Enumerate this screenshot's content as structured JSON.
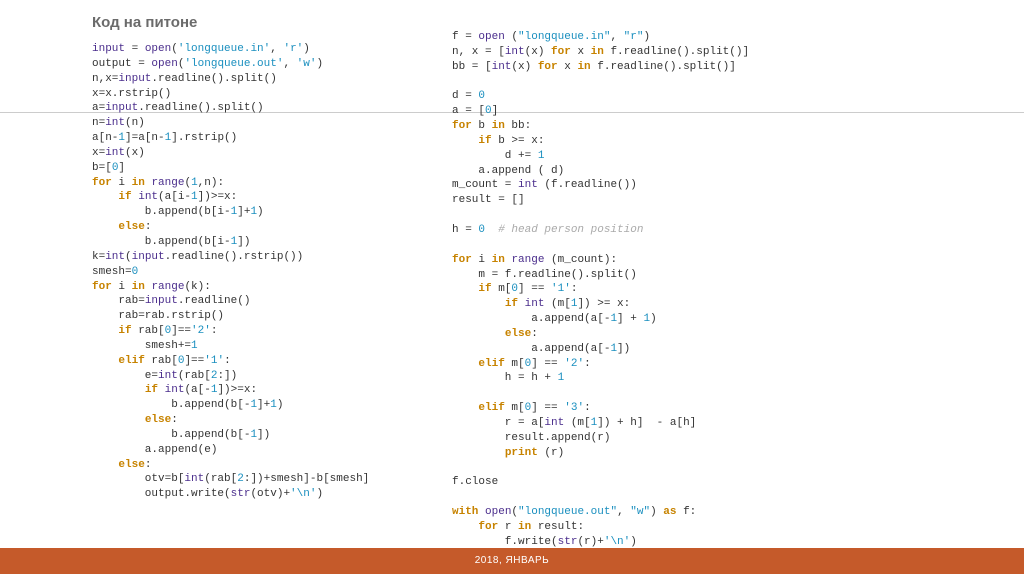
{
  "title": "Код на питоне",
  "footer": "2018, ЯНВАРЬ",
  "code1": {
    "l1": {
      "a": "input",
      "b": " = ",
      "c": "open",
      "d": "(",
      "e": "'longqueue.in'",
      "f": ", ",
      "g": "'r'",
      "h": ")"
    },
    "l2": {
      "a": "output = ",
      "b": "open",
      "c": "(",
      "d": "'longqueue.out'",
      "e": ", ",
      "f": "'w'",
      "g": ")"
    },
    "l3": {
      "a": "n,x=",
      "b": "input",
      "c": ".readline().split()"
    },
    "l4": "x=x.rstrip()",
    "l5": {
      "a": "a=",
      "b": "input",
      "c": ".readline().split()"
    },
    "l6": {
      "a": "n=",
      "b": "int",
      "c": "(n)"
    },
    "l7": {
      "a": "a[n-",
      "b": "1",
      "c": "]=a[n-",
      "d": "1",
      "e": "].rstrip()"
    },
    "l8": {
      "a": "x=",
      "b": "int",
      "c": "(x)"
    },
    "l9": {
      "a": "b=[",
      "b": "0",
      "c": "]"
    },
    "l10": {
      "a": "for",
      "b": " i ",
      "c": "in",
      "d": " ",
      "e": "range",
      "f": "(",
      "g": "1",
      "h": ",n):"
    },
    "l11": {
      "a": "    ",
      "b": "if",
      "c": " ",
      "d": "int",
      "e": "(a[i-",
      "f": "1",
      "g": "])>=x:"
    },
    "l12": {
      "a": "        b.append(b[i-",
      "b": "1",
      "c": "]+",
      "d": "1",
      "e": ")"
    },
    "l13": {
      "a": "    ",
      "b": "else",
      "c": ":"
    },
    "l14": {
      "a": "        b.append(b[i-",
      "b": "1",
      "c": "])"
    },
    "l15": {
      "a": "k=",
      "b": "int",
      "c": "(",
      "d": "input",
      "e": ".readline().rstrip())"
    },
    "l16": {
      "a": "smesh=",
      "b": "0"
    },
    "l17": {
      "a": "for",
      "b": " i ",
      "c": "in",
      "d": " ",
      "e": "range",
      "f": "(k):"
    },
    "l18": {
      "a": "    rab=",
      "b": "input",
      "c": ".readline()"
    },
    "l19": "    rab=rab.rstrip()",
    "l20": {
      "a": "    ",
      "b": "if",
      "c": " rab[",
      "d": "0",
      "e": "]==",
      "f": "'2'",
      "g": ":"
    },
    "l21": {
      "a": "        smesh+=",
      "b": "1"
    },
    "l22": {
      "a": "    ",
      "b": "elif",
      "c": " rab[",
      "d": "0",
      "e": "]==",
      "f": "'1'",
      "g": ":"
    },
    "l23": {
      "a": "        e=",
      "b": "int",
      "c": "(rab[",
      "d": "2",
      "e": ":])"
    },
    "l24": {
      "a": "        ",
      "b": "if",
      "c": " ",
      "d": "int",
      "e": "(a[-",
      "f": "1",
      "g": "])>=x:"
    },
    "l25": {
      "a": "            b.append(b[-",
      "b": "1",
      "c": "]+",
      "d": "1",
      "e": ")"
    },
    "l26": {
      "a": "        ",
      "b": "else",
      "c": ":"
    },
    "l27": {
      "a": "            b.append(b[-",
      "b": "1",
      "c": "])"
    },
    "l28": "        a.append(e)",
    "l29": {
      "a": "    ",
      "b": "else",
      "c": ":"
    },
    "l30": {
      "a": "        otv=b[",
      "b": "int",
      "c": "(rab[",
      "d": "2",
      "e": ":])+smesh]-b[smesh]"
    },
    "l31": {
      "a": "        output.write(",
      "b": "str",
      "c": "(otv)+",
      "d": "'\\n'",
      "e": ")"
    }
  },
  "code2": {
    "l1": {
      "a": "f = ",
      "b": "open",
      "c": " (",
      "d": "\"longqueue.in\"",
      "e": ", ",
      "f": "\"r\"",
      "g": ")"
    },
    "l2": {
      "a": "n, x = [",
      "b": "int",
      "c": "(x) ",
      "d": "for",
      "e": " x ",
      "f": "in",
      "g": " f.readline().split()]"
    },
    "l3": {
      "a": "bb = [",
      "b": "int",
      "c": "(x) ",
      "d": "for",
      "e": " x ",
      "f": "in",
      "g": " f.readline().split()]"
    },
    "l5": {
      "a": "d = ",
      "b": "0"
    },
    "l6": {
      "a": "a = [",
      "b": "0",
      "c": "]"
    },
    "l7": {
      "a": "for",
      "b": " b ",
      "c": "in",
      "d": " bb:"
    },
    "l8": {
      "a": "    ",
      "b": "if",
      "c": " b >= x:"
    },
    "l9": {
      "a": "        d += ",
      "b": "1"
    },
    "l10": "    a.append ( d)",
    "l11": {
      "a": "m_count = ",
      "b": "int",
      "c": " (f.readline())"
    },
    "l12": "result = []",
    "l14": {
      "a": "h = ",
      "b": "0",
      "c": "  ",
      "d": "# head person position"
    },
    "l16": {
      "a": "for",
      "b": " i ",
      "c": "in",
      "d": " ",
      "e": "range",
      "f": " (m_count):"
    },
    "l17": "    m = f.readline().split()",
    "l18": {
      "a": "    ",
      "b": "if",
      "c": " m[",
      "d": "0",
      "e": "] == ",
      "f": "'1'",
      "g": ":"
    },
    "l19": {
      "a": "        ",
      "b": "if",
      "c": " ",
      "d": "int",
      "e": " (m[",
      "f": "1",
      "g": "]) >= x:"
    },
    "l20": {
      "a": "            a.append(a[-",
      "b": "1",
      "c": "] + ",
      "d": "1",
      "e": ")"
    },
    "l21": {
      "a": "        ",
      "b": "else",
      "c": ":"
    },
    "l22": {
      "a": "            a.append(a[-",
      "b": "1",
      "c": "])"
    },
    "l23": {
      "a": "    ",
      "b": "elif",
      "c": " m[",
      "d": "0",
      "e": "] == ",
      "f": "'2'",
      "g": ":"
    },
    "l24": {
      "a": "        h = h + ",
      "b": "1"
    },
    "l26": {
      "a": "    ",
      "b": "elif",
      "c": " m[",
      "d": "0",
      "e": "] == ",
      "f": "'3'",
      "g": ":"
    },
    "l27": {
      "a": "        r = a[",
      "b": "int",
      "c": " (m[",
      "d": "1",
      "e": "]) + h]  - a[h]"
    },
    "l28": "        result.append(r)",
    "l29": {
      "a": "        ",
      "b": "print",
      "c": " (r)"
    },
    "l31": "f.close",
    "l33": {
      "a": "with",
      "b": " ",
      "c": "open",
      "d": "(",
      "e": "\"longqueue.out\"",
      "f": ", ",
      "g": "\"w\"",
      "h": ") ",
      "i": "as",
      "j": " f:"
    },
    "l34": {
      "a": "    ",
      "b": "for",
      "c": " r ",
      "d": "in",
      "e": " result:"
    },
    "l35": {
      "a": "        f.write(",
      "b": "str",
      "c": "(r)+",
      "d": "'\\n'",
      "e": ")"
    }
  }
}
